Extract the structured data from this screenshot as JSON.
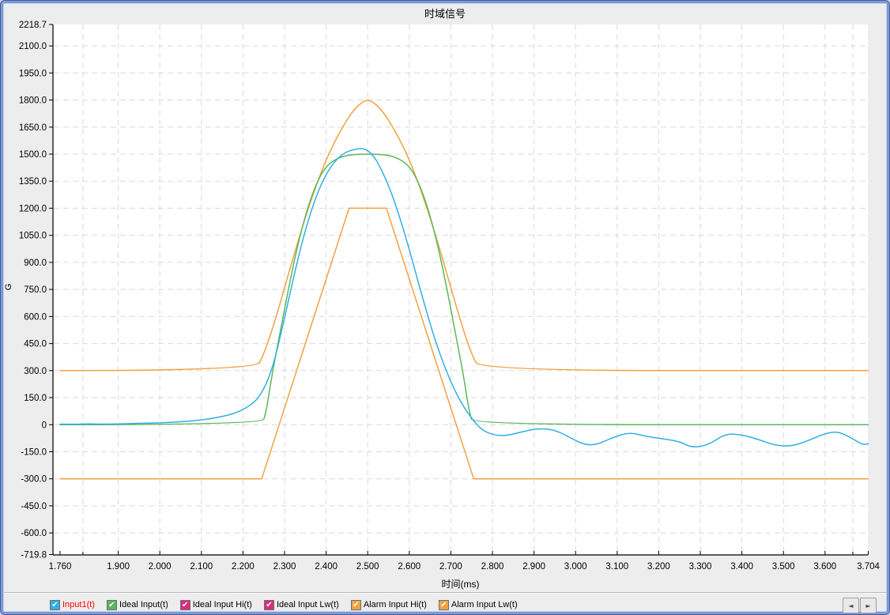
{
  "window": {
    "title": "时域信号"
  },
  "icons": {
    "checkbox_check": "✔",
    "scroll_left": "◄",
    "scroll_right": "►"
  },
  "colors": {
    "plot_background": "#ffffff",
    "panel_background": "#ededed",
    "grid": "#d9d9d9",
    "axis": "#000000",
    "input1_line": "#2fb0e4",
    "ideal_line": "#5bb75b",
    "ideal_limit_swatch": "#da2e7d",
    "alarm_line": "#f0a23f",
    "selected_legend_text": "#ff0000",
    "legend_text": "#000000"
  },
  "legend": {
    "items": [
      {
        "id": "input1",
        "label": "Input1(t)",
        "swatch": "#2fb0e4",
        "text_color": "#ff0000",
        "checked": true
      },
      {
        "id": "ideal-input",
        "label": "Ideal Input(t)",
        "swatch": "#5bb75b",
        "text_color": "#000000",
        "checked": true
      },
      {
        "id": "ideal-input-hi",
        "label": "Ideal Input Hi(t)",
        "swatch": "#da2e7d",
        "text_color": "#000000",
        "checked": true
      },
      {
        "id": "ideal-input-lw",
        "label": "Ideal Input Lw(t)",
        "swatch": "#da2e7d",
        "text_color": "#000000",
        "checked": true
      },
      {
        "id": "alarm-input-hi",
        "label": "Alarm Input Hi(t)",
        "swatch": "#f0a23f",
        "text_color": "#000000",
        "checked": true
      },
      {
        "id": "alarm-input-lw",
        "label": "Alarm Input Lw(t)",
        "swatch": "#f0a23f",
        "text_color": "#000000",
        "checked": true
      }
    ]
  },
  "chart_data": {
    "type": "line",
    "title": "时域信号",
    "xlabel": "时间(ms)",
    "ylabel": "G",
    "xlim": [
      1.76,
      3.704
    ],
    "ylim": [
      -719.8,
      2218.7
    ],
    "grid": true,
    "legend_position": "bottom",
    "x_ticks": [
      {
        "v": 1.76,
        "label": "1.760"
      },
      {
        "v": 1.9,
        "label": "1.900"
      },
      {
        "v": 2.0,
        "label": "2.000"
      },
      {
        "v": 2.1,
        "label": "2.100"
      },
      {
        "v": 2.2,
        "label": "2.200"
      },
      {
        "v": 2.3,
        "label": "2.300"
      },
      {
        "v": 2.4,
        "label": "2.400"
      },
      {
        "v": 2.5,
        "label": "2.500"
      },
      {
        "v": 2.6,
        "label": "2.600"
      },
      {
        "v": 2.7,
        "label": "2.700"
      },
      {
        "v": 2.8,
        "label": "2.800"
      },
      {
        "v": 2.9,
        "label": "2.900"
      },
      {
        "v": 3.0,
        "label": "3.000"
      },
      {
        "v": 3.1,
        "label": "3.100"
      },
      {
        "v": 3.2,
        "label": "3.200"
      },
      {
        "v": 3.3,
        "label": "3.300"
      },
      {
        "v": 3.4,
        "label": "3.400"
      },
      {
        "v": 3.5,
        "label": "3.500"
      },
      {
        "v": 3.6,
        "label": "3.600"
      },
      {
        "v": 3.704,
        "label": "3.704"
      }
    ],
    "x_minor_ticks": [
      1.815,
      3.667
    ],
    "y_ticks": [
      {
        "v": 2218.7,
        "label": "2218.7"
      },
      {
        "v": 2100.0,
        "label": "2100.0"
      },
      {
        "v": 1950.0,
        "label": "1950.0"
      },
      {
        "v": 1800.0,
        "label": "1800.0"
      },
      {
        "v": 1650.0,
        "label": "1650.0"
      },
      {
        "v": 1500.0,
        "label": "1500.0"
      },
      {
        "v": 1350.0,
        "label": "1350.0"
      },
      {
        "v": 1200.0,
        "label": "1200.0"
      },
      {
        "v": 1050.0,
        "label": "1050.0"
      },
      {
        "v": 900.0,
        "label": "900.0"
      },
      {
        "v": 750.0,
        "label": "750.0"
      },
      {
        "v": 600.0,
        "label": "600.0"
      },
      {
        "v": 450.0,
        "label": "450.0"
      },
      {
        "v": 300.0,
        "label": "300.0"
      },
      {
        "v": 150.0,
        "label": "150.0"
      },
      {
        "v": 0,
        "label": "0"
      },
      {
        "v": -150.0,
        "label": "-150.0"
      },
      {
        "v": -300.0,
        "label": "-300.0"
      },
      {
        "v": -450.0,
        "label": "-450.0"
      },
      {
        "v": -600.0,
        "label": "-600.0"
      },
      {
        "v": -719.8,
        "label": "-719.8"
      }
    ],
    "series": [
      {
        "id": "ideal-input-hi",
        "name": "Ideal Input Hi(t)",
        "color": "#da2e7d",
        "smooth": false,
        "visible_in_plot": false,
        "points": []
      },
      {
        "id": "ideal-input-lw",
        "name": "Ideal Input Lw(t)",
        "color": "#da2e7d",
        "smooth": false,
        "visible_in_plot": false,
        "points": []
      },
      {
        "id": "alarm-input-hi",
        "name": "Alarm Input Hi(t)",
        "color": "#f0a23f",
        "smooth": true,
        "visible_in_plot": true,
        "points": [
          [
            1.76,
            300
          ],
          [
            2.23,
            300
          ],
          [
            2.25,
            390
          ],
          [
            2.275,
            560
          ],
          [
            2.3,
            760
          ],
          [
            2.325,
            960
          ],
          [
            2.35,
            1150
          ],
          [
            2.375,
            1320
          ],
          [
            2.4,
            1470
          ],
          [
            2.425,
            1590
          ],
          [
            2.45,
            1690
          ],
          [
            2.47,
            1755
          ],
          [
            2.49,
            1793
          ],
          [
            2.5,
            1800
          ],
          [
            2.51,
            1793
          ],
          [
            2.53,
            1755
          ],
          [
            2.55,
            1690
          ],
          [
            2.575,
            1590
          ],
          [
            2.6,
            1470
          ],
          [
            2.625,
            1320
          ],
          [
            2.65,
            1150
          ],
          [
            2.675,
            960
          ],
          [
            2.7,
            760
          ],
          [
            2.725,
            560
          ],
          [
            2.75,
            390
          ],
          [
            2.77,
            300
          ],
          [
            3.704,
            300
          ]
        ]
      },
      {
        "id": "alarm-input-lw",
        "name": "Alarm Input Lw(t)",
        "color": "#f0a23f",
        "smooth": false,
        "visible_in_plot": true,
        "points": [
          [
            1.76,
            -300
          ],
          [
            2.245,
            -300
          ],
          [
            2.455,
            1200
          ],
          [
            2.545,
            1200
          ],
          [
            2.755,
            -300
          ],
          [
            3.704,
            -300
          ]
        ]
      },
      {
        "id": "ideal-input",
        "name": "Ideal Input(t)",
        "color": "#5bb75b",
        "smooth": true,
        "visible_in_plot": true,
        "points": [
          [
            1.76,
            0
          ],
          [
            2.245,
            0
          ],
          [
            2.255,
            60
          ],
          [
            2.27,
            280
          ],
          [
            2.29,
            520
          ],
          [
            2.31,
            760
          ],
          [
            2.33,
            980
          ],
          [
            2.35,
            1160
          ],
          [
            2.37,
            1300
          ],
          [
            2.39,
            1400
          ],
          [
            2.41,
            1455
          ],
          [
            2.44,
            1490
          ],
          [
            2.47,
            1499
          ],
          [
            2.5,
            1500
          ],
          [
            2.53,
            1499
          ],
          [
            2.56,
            1490
          ],
          [
            2.59,
            1455
          ],
          [
            2.61,
            1400
          ],
          [
            2.63,
            1300
          ],
          [
            2.65,
            1160
          ],
          [
            2.67,
            980
          ],
          [
            2.69,
            760
          ],
          [
            2.71,
            520
          ],
          [
            2.73,
            280
          ],
          [
            2.745,
            60
          ],
          [
            2.755,
            0
          ],
          [
            3.704,
            0
          ]
        ]
      },
      {
        "id": "input1",
        "name": "Input1(t)",
        "color": "#2fb0e4",
        "smooth": true,
        "visible_in_plot": true,
        "points": [
          [
            1.76,
            3
          ],
          [
            1.8,
            2
          ],
          [
            1.82,
            5
          ],
          [
            1.85,
            3
          ],
          [
            1.9,
            4
          ],
          [
            1.95,
            8
          ],
          [
            2.0,
            10
          ],
          [
            2.05,
            16
          ],
          [
            2.1,
            26
          ],
          [
            2.14,
            40
          ],
          [
            2.18,
            62
          ],
          [
            2.21,
            95
          ],
          [
            2.24,
            150
          ],
          [
            2.27,
            300
          ],
          [
            2.295,
            540
          ],
          [
            2.32,
            800
          ],
          [
            2.345,
            1040
          ],
          [
            2.37,
            1230
          ],
          [
            2.395,
            1370
          ],
          [
            2.42,
            1460
          ],
          [
            2.445,
            1510
          ],
          [
            2.47,
            1528
          ],
          [
            2.49,
            1532
          ],
          [
            2.51,
            1505
          ],
          [
            2.53,
            1430
          ],
          [
            2.555,
            1300
          ],
          [
            2.58,
            1130
          ],
          [
            2.605,
            930
          ],
          [
            2.63,
            720
          ],
          [
            2.655,
            520
          ],
          [
            2.68,
            350
          ],
          [
            2.705,
            210
          ],
          [
            2.73,
            100
          ],
          [
            2.755,
            20
          ],
          [
            2.775,
            -30
          ],
          [
            2.8,
            -55
          ],
          [
            2.83,
            -63
          ],
          [
            2.87,
            -40
          ],
          [
            2.91,
            -20
          ],
          [
            2.95,
            -28
          ],
          [
            2.99,
            -75
          ],
          [
            3.02,
            -110
          ],
          [
            3.05,
            -112
          ],
          [
            3.09,
            -70
          ],
          [
            3.13,
            -42
          ],
          [
            3.17,
            -65
          ],
          [
            3.21,
            -78
          ],
          [
            3.25,
            -92
          ],
          [
            3.28,
            -128
          ],
          [
            3.32,
            -112
          ],
          [
            3.36,
            -50
          ],
          [
            3.4,
            -55
          ],
          [
            3.44,
            -82
          ],
          [
            3.48,
            -115
          ],
          [
            3.52,
            -120
          ],
          [
            3.56,
            -88
          ],
          [
            3.6,
            -48
          ],
          [
            3.63,
            -38
          ],
          [
            3.66,
            -68
          ],
          [
            3.69,
            -112
          ],
          [
            3.704,
            -106
          ]
        ]
      }
    ]
  }
}
